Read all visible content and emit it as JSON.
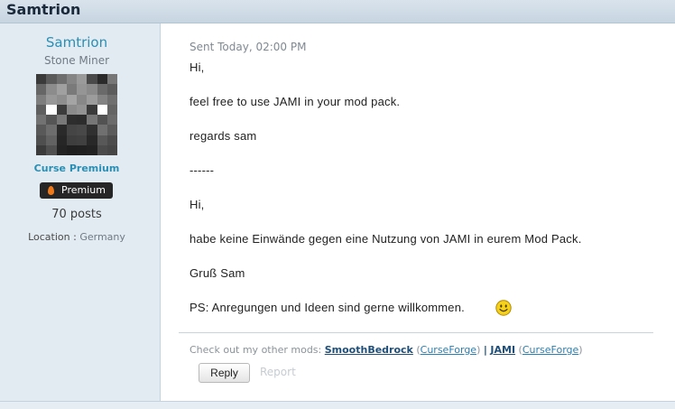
{
  "header": {
    "title": "Samtrion"
  },
  "author": {
    "username": "Samtrion",
    "rank": "Stone Miner",
    "membership": "Curse Premium",
    "badge": "Premium",
    "posts": "70 posts",
    "location_label": "Location :",
    "location_value": "Germany"
  },
  "post": {
    "sent": "Sent Today, 02:00 PM",
    "lines": [
      "Hi,",
      "feel free to use JAMI in your mod pack.",
      "regards sam",
      "------",
      "Hi,",
      "habe keine Einwände gegen eine Nutzung von JAMI in eurem Mod Pack.",
      "Gruß Sam",
      "PS: Anregungen und Ideen sind gerne willkommen."
    ]
  },
  "signature": {
    "prefix": "Check out my other mods:",
    "mod1": "SmoothBedrock",
    "mod1_link": "CurseForge",
    "separator": "|",
    "mod2": "JAMI",
    "mod2_link": "CurseForge"
  },
  "actions": {
    "reply": "Reply",
    "report": "Report"
  },
  "icons": {
    "smiley": "smiley-icon",
    "flame": "flame-icon"
  },
  "colors": {
    "accent": "#2a8fb4",
    "sidebar_bg": "#e3ebf2",
    "badge_bg": "#262626"
  }
}
